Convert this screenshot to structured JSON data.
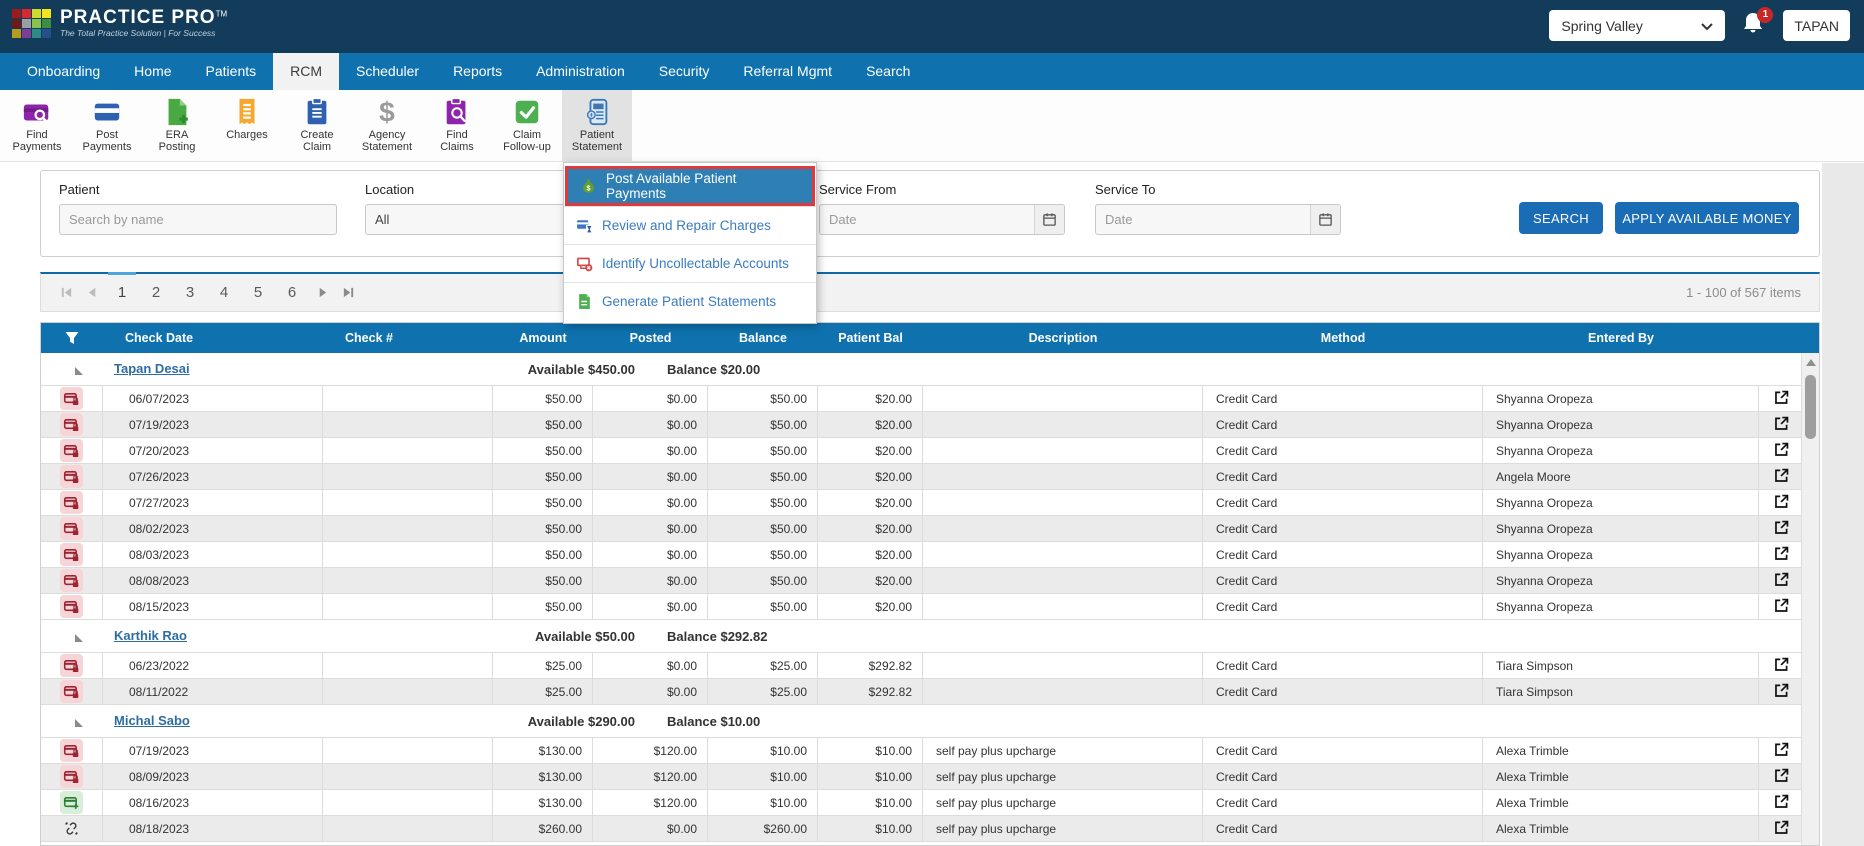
{
  "brand": {
    "name": "Practice Pro",
    "tm": "TM",
    "tagline": "The Total Practice Solution | For Success",
    "logo_colors": [
      "#9b1b1f",
      "#d7282f",
      "#cddc2a",
      "#f5e31d",
      "#6e1a1d",
      "#9aa0a4",
      "#8bc34a",
      "#3e8e41",
      "#b79b1e",
      "#7b3f98",
      "#2a8c84",
      "#274e8d"
    ]
  },
  "topbar": {
    "location": "Spring Valley",
    "notification_count": "1",
    "user": "TAPAN"
  },
  "nav": {
    "items": [
      {
        "label": "Onboarding",
        "active": false
      },
      {
        "label": "Home",
        "active": false
      },
      {
        "label": "Patients",
        "active": false
      },
      {
        "label": "RCM",
        "active": true
      },
      {
        "label": "Scheduler",
        "active": false
      },
      {
        "label": "Reports",
        "active": false
      },
      {
        "label": "Administration",
        "active": false
      },
      {
        "label": "Security",
        "active": false
      },
      {
        "label": "Referral Mgmt",
        "active": false
      },
      {
        "label": "Search",
        "active": false
      }
    ]
  },
  "toolbar": {
    "items": [
      {
        "label": [
          "Find",
          "Payments"
        ],
        "icon": "find-payments",
        "color": "#8e24aa",
        "active": false
      },
      {
        "label": [
          "Post",
          "Payments"
        ],
        "icon": "post-payments",
        "color": "#2e62b1",
        "active": false
      },
      {
        "label": [
          "ERA",
          "Posting"
        ],
        "icon": "era-posting",
        "color": "#49a942",
        "active": false
      },
      {
        "label": [
          "Charges"
        ],
        "icon": "charges",
        "color": "#f5a82d",
        "active": false
      },
      {
        "label": [
          "Create",
          "Claim"
        ],
        "icon": "create-claim",
        "color": "#2e62b1",
        "active": false
      },
      {
        "label": [
          "Agency",
          "Statement"
        ],
        "icon": "agency-statement",
        "color": "#9a9a9a",
        "active": false
      },
      {
        "label": [
          "Find",
          "Claims"
        ],
        "icon": "find-claims",
        "color": "#8e24aa",
        "active": false
      },
      {
        "label": [
          "Claim",
          "Follow-up"
        ],
        "icon": "claim-followup",
        "color": "#4caf50",
        "active": false
      },
      {
        "label": [
          "Patient",
          "Statement"
        ],
        "icon": "patient-statement",
        "color": "#5b9bd5",
        "active": true
      }
    ]
  },
  "menu": {
    "items": [
      {
        "label": "Post Available Patient Payments",
        "icon": "money-bag",
        "selected": true,
        "highlighted": true
      },
      {
        "label": "Review and Repair Charges",
        "icon": "review-repair",
        "selected": false,
        "highlighted": false
      },
      {
        "label": "Identify Uncollectable Accounts",
        "icon": "uncollectable",
        "selected": false,
        "highlighted": false
      },
      {
        "label": "Generate Patient Statements",
        "icon": "generate-statements",
        "selected": false,
        "highlighted": false
      }
    ]
  },
  "filters": {
    "patient_label": "Patient",
    "patient_placeholder": "Search by name",
    "location_label": "Location",
    "location_value": "All",
    "service_from_label": "Service From",
    "service_from_placeholder": "Date",
    "service_to_label": "Service To",
    "service_to_placeholder": "Date",
    "search_button": "SEARCH",
    "apply_button": "APPLY AVAILABLE MONEY"
  },
  "pagination": {
    "pages": [
      "1",
      "2",
      "3",
      "4",
      "5",
      "6"
    ],
    "active": "1",
    "summary": "1 - 100 of 567 items"
  },
  "table": {
    "columns": [
      "Check Date",
      "Check #",
      "Amount",
      "Posted",
      "Balance",
      "Patient Bal",
      "Description",
      "Method",
      "Entered By"
    ],
    "groups": [
      {
        "name": "Tapan Desai",
        "available": "Available $450.00",
        "balance": "Balance $20.00",
        "rows": [
          {
            "icon": "card-locked",
            "date": "06/07/2023",
            "check": "",
            "amount": "$50.00",
            "posted": "$0.00",
            "balance": "$50.00",
            "patient_bal": "$20.00",
            "desc": "",
            "method": "Credit Card",
            "entered": "Shyanna Oropeza"
          },
          {
            "icon": "card-locked",
            "date": "07/19/2023",
            "check": "",
            "amount": "$50.00",
            "posted": "$0.00",
            "balance": "$50.00",
            "patient_bal": "$20.00",
            "desc": "",
            "method": "Credit Card",
            "entered": "Shyanna Oropeza"
          },
          {
            "icon": "card-locked",
            "date": "07/20/2023",
            "check": "",
            "amount": "$50.00",
            "posted": "$0.00",
            "balance": "$50.00",
            "patient_bal": "$20.00",
            "desc": "",
            "method": "Credit Card",
            "entered": "Shyanna Oropeza"
          },
          {
            "icon": "card-locked",
            "date": "07/26/2023",
            "check": "",
            "amount": "$50.00",
            "posted": "$0.00",
            "balance": "$50.00",
            "patient_bal": "$20.00",
            "desc": "",
            "method": "Credit Card",
            "entered": "Angela Moore"
          },
          {
            "icon": "card-locked",
            "date": "07/27/2023",
            "check": "",
            "amount": "$50.00",
            "posted": "$0.00",
            "balance": "$50.00",
            "patient_bal": "$20.00",
            "desc": "",
            "method": "Credit Card",
            "entered": "Shyanna Oropeza"
          },
          {
            "icon": "card-locked",
            "date": "08/02/2023",
            "check": "",
            "amount": "$50.00",
            "posted": "$0.00",
            "balance": "$50.00",
            "patient_bal": "$20.00",
            "desc": "",
            "method": "Credit Card",
            "entered": "Shyanna Oropeza"
          },
          {
            "icon": "card-locked",
            "date": "08/03/2023",
            "check": "",
            "amount": "$50.00",
            "posted": "$0.00",
            "balance": "$50.00",
            "patient_bal": "$20.00",
            "desc": "",
            "method": "Credit Card",
            "entered": "Shyanna Oropeza"
          },
          {
            "icon": "card-locked",
            "date": "08/08/2023",
            "check": "",
            "amount": "$50.00",
            "posted": "$0.00",
            "balance": "$50.00",
            "patient_bal": "$20.00",
            "desc": "",
            "method": "Credit Card",
            "entered": "Shyanna Oropeza"
          },
          {
            "icon": "card-locked",
            "date": "08/15/2023",
            "check": "",
            "amount": "$50.00",
            "posted": "$0.00",
            "balance": "$50.00",
            "patient_bal": "$20.00",
            "desc": "",
            "method": "Credit Card",
            "entered": "Shyanna Oropeza"
          }
        ]
      },
      {
        "name": "Karthik Rao",
        "available": "Available $50.00",
        "balance": "Balance $292.82",
        "rows": [
          {
            "icon": "card-locked",
            "date": "06/23/2022",
            "check": "",
            "amount": "$25.00",
            "posted": "$0.00",
            "balance": "$25.00",
            "patient_bal": "$292.82",
            "desc": "",
            "method": "Credit Card",
            "entered": "Tiara Simpson"
          },
          {
            "icon": "card-locked",
            "date": "08/11/2022",
            "check": "",
            "amount": "$25.00",
            "posted": "$0.00",
            "balance": "$25.00",
            "patient_bal": "$292.82",
            "desc": "",
            "method": "Credit Card",
            "entered": "Tiara Simpson"
          }
        ]
      },
      {
        "name": "Michal Sabo",
        "available": "Available $290.00",
        "balance": "Balance $10.00",
        "rows": [
          {
            "icon": "card-locked",
            "date": "07/19/2023",
            "check": "",
            "amount": "$130.00",
            "posted": "$120.00",
            "balance": "$10.00",
            "patient_bal": "$10.00",
            "desc": "self pay plus upcharge",
            "method": "Credit Card",
            "entered": "Alexa Trimble"
          },
          {
            "icon": "card-locked",
            "date": "08/09/2023",
            "check": "",
            "amount": "$130.00",
            "posted": "$120.00",
            "balance": "$10.00",
            "patient_bal": "$10.00",
            "desc": "self pay plus upcharge",
            "method": "Credit Card",
            "entered": "Alexa Trimble"
          },
          {
            "icon": "card-add",
            "date": "08/16/2023",
            "check": "",
            "amount": "$130.00",
            "posted": "$120.00",
            "balance": "$10.00",
            "patient_bal": "$10.00",
            "desc": "self pay plus upcharge",
            "method": "Credit Card",
            "entered": "Alexa Trimble"
          },
          {
            "icon": "unlink",
            "date": "08/18/2023",
            "check": "",
            "amount": "$260.00",
            "posted": "$0.00",
            "balance": "$260.00",
            "patient_bal": "$10.00",
            "desc": "self pay plus upcharge",
            "method": "Credit Card",
            "entered": "Alexa Trimble"
          }
        ]
      }
    ]
  },
  "colors": {
    "topbar": "#123c5a",
    "nav": "#0f72ae",
    "grid_header": "#0f72ae",
    "primary_button": "#1a6cb4",
    "menu_selected": "#2e7fb4",
    "highlight_border": "#e0393c"
  }
}
